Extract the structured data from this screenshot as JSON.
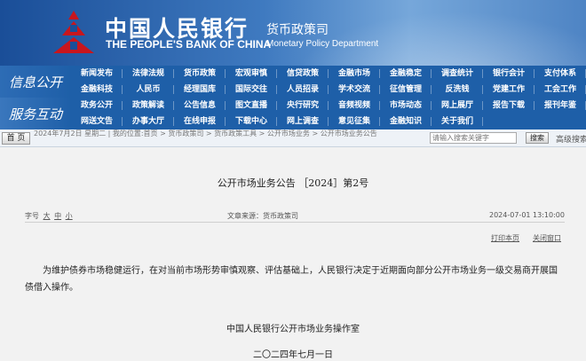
{
  "header": {
    "bank_name_cn": "中国人民银行",
    "bank_name_en": "THE PEOPLE'S BANK OF CHINA",
    "dept_cn": "货币政策司",
    "dept_en": "Monetary Policy Department",
    "logo_color": "#c8161d"
  },
  "nav": {
    "section1_label": "信息公开",
    "section2_label": "服务互动",
    "rows": [
      [
        "新闻发布",
        "法律法规",
        "货币政策",
        "宏观审慎",
        "信贷政策",
        "金融市场",
        "金融稳定",
        "调查统计",
        "银行会计",
        "支付体系"
      ],
      [
        "金融科技",
        "人民币",
        "经理国库",
        "国际交往",
        "人员招录",
        "学术交流",
        "征信管理",
        "反洗钱",
        "党建工作",
        "工会工作"
      ],
      [
        "政务公开",
        "政策解读",
        "公告信息",
        "图文直播",
        "央行研究",
        "音频视频",
        "市场动态",
        "网上展厅",
        "报告下载",
        "报刊年鉴"
      ],
      [
        "网送文告",
        "办事大厅",
        "在线申报",
        "下载中心",
        "网上调查",
        "意见征集",
        "金融知识",
        "关于我们"
      ]
    ]
  },
  "breadcrumb": {
    "home_label": "首 页",
    "text": "2024年7月2日 星期二 | 我的位置:首页 > 货币政策司 > 货币政策工具 > 公开市场业务 > 公开市场业务公告",
    "search_placeholder": "请输入搜索关键字",
    "search_button": "搜索",
    "advanced_search": "高级搜索"
  },
  "article": {
    "title": "公开市场业务公告 ［2024］第2号",
    "font_label": "字号",
    "font_large": "大",
    "font_medium": "中",
    "font_small": "小",
    "source": "文章来源：货币政策司",
    "date": "2024-07-01 13:10:00",
    "print_label": "打印本页",
    "close_label": "关闭窗口",
    "body": "为维护债券市场稳健运行，在对当前市场形势审慎观察、评估基础上，人民银行决定于近期面向部分公开市场业务一级交易商开展国债借入操作。",
    "signature": "中国人民银行公开市场业务操作室",
    "sign_date": "二〇二四年七月一日"
  }
}
